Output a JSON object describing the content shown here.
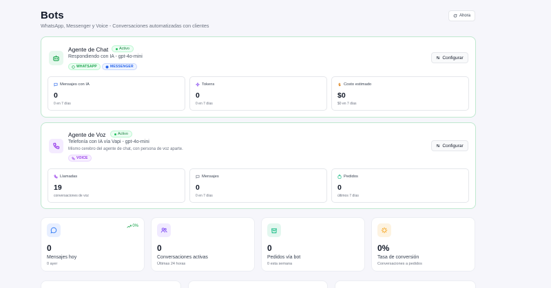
{
  "header": {
    "title": "Bots",
    "subtitle": "WhatsApp, Messenger y Voice - Conversaciones automatizadas con clientes",
    "refresh_label": "Ahora"
  },
  "chat_bot": {
    "name": "Agente de Chat",
    "status": "Activo",
    "subtitle": "Respondiendo con IA - gpt-4o-mini",
    "channels": [
      "WHATSAPP",
      "MESSENGER"
    ],
    "configure_label": "Configurar",
    "stats": [
      {
        "label": "Mensajes con IA",
        "value": "0",
        "note": "0 en 7 días",
        "icon": "message-icon"
      },
      {
        "label": "Tokens",
        "value": "0",
        "note": "0 en 7 días",
        "icon": "sparkle-icon"
      },
      {
        "label": "Costo estimado",
        "value": "$0",
        "note": "$0 en 7 días",
        "icon": "dollar-icon"
      }
    ]
  },
  "voice_bot": {
    "name": "Agente de Voz",
    "status": "Activo",
    "subtitle": "Telefonía con IA vía Vapi - gpt-4o-mini",
    "description": "Mismo cerebro del agente de chat, con persona de voz aparte.",
    "channels": [
      "VOICE"
    ],
    "configure_label": "Configurar",
    "stats": [
      {
        "label": "Llamadas",
        "value": "19",
        "note": "conversaciones de voz",
        "icon": "phone-icon"
      },
      {
        "label": "Mensajes",
        "value": "0",
        "note": "0 en 7 días",
        "icon": "message-icon"
      },
      {
        "label": "Pedidos",
        "value": "0",
        "note": "últimos 7 días",
        "icon": "bag-icon"
      }
    ]
  },
  "kpis": [
    {
      "value": "0",
      "label": "Mensajes hoy",
      "note": "0 ayer",
      "trend": "0%",
      "icon": "chat-bubble-icon",
      "color": "#3b82f6",
      "bg": "#e8efff"
    },
    {
      "value": "0",
      "label": "Conversaciones activas",
      "note": "Últimas 24 horas",
      "icon": "users-icon",
      "color": "#8b5cf6",
      "bg": "#f1ebff"
    },
    {
      "value": "0",
      "label": "Pedidos vía bot",
      "note": "0 esta semana",
      "icon": "shopping-bag-icon",
      "color": "#10b981",
      "bg": "#e3f7ef"
    },
    {
      "value": "0%",
      "label": "Tasa de conversión",
      "note": "Conversaciones a pedidos",
      "icon": "zap-icon",
      "color": "#f59e0b",
      "bg": "#fdf3e1"
    }
  ],
  "colors": {
    "accent_green": "#22c55e",
    "whatsapp": "#16a34a",
    "messenger": "#2563eb",
    "voice": "#9333ea"
  }
}
